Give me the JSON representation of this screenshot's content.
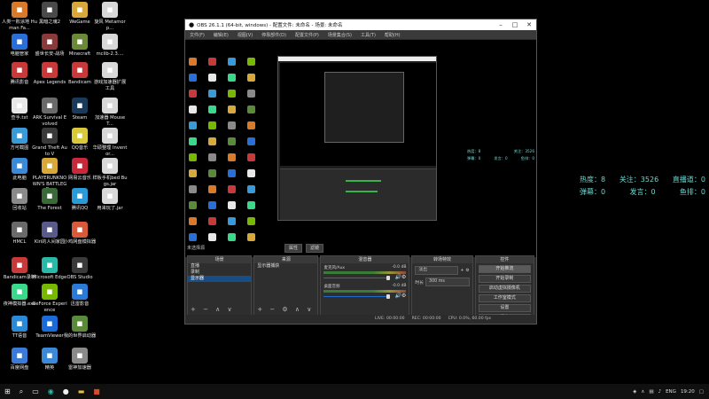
{
  "desktop": {
    "icons": [
      {
        "label": "人类一败涂地 Human Fa...",
        "icon": "game-icon",
        "color": "#d87a2a"
      },
      {
        "label": "电脑管家",
        "icon": "shield-icon",
        "color": "#2a6fd8"
      },
      {
        "label": "腾讯影音",
        "icon": "video-icon",
        "color": "#c83a3a"
      },
      {
        "label": "查手.txt",
        "icon": "text-file-icon",
        "color": "#e8e8e8"
      },
      {
        "label": "方可截图",
        "icon": "screenshot-icon",
        "color": "#3a9ad8"
      },
      {
        "label": "此电脑",
        "icon": "computer-icon",
        "color": "#3a8ad8"
      },
      {
        "label": "回收站",
        "icon": "recycle-bin-icon",
        "color": "#8a8a8a"
      },
      {
        "label": "HMCL",
        "icon": "minecraft-launcher-icon",
        "color": "#6a6a6a"
      },
      {
        "label": "Bandicam录制",
        "icon": "bandicam-icon",
        "color": "#c83a3a"
      },
      {
        "label": "夜神模拟器.exe",
        "icon": "android-emulator-icon",
        "color": "#3ad88a"
      },
      {
        "label": "TT语音",
        "icon": "tt-voice-icon",
        "color": "#2a8ad8"
      },
      {
        "label": "百度网盘",
        "icon": "cloud-drive-icon",
        "color": "#3a7ad8"
      },
      {
        "label": "黑暗之魂2",
        "icon": "game-icon",
        "color": "#4a4a4a"
      },
      {
        "label": "盛世长安-战场",
        "icon": "game-icon",
        "color": "#8a3a3a"
      },
      {
        "label": "Apex Legends",
        "icon": "apex-icon",
        "color": "#c83a3a"
      },
      {
        "label": "ARK Survival Evolved",
        "icon": "ark-icon",
        "color": "#6a6a6a"
      },
      {
        "label": "Grand Theft Auto V",
        "icon": "gta-icon",
        "color": "#3a3a3a"
      },
      {
        "label": "PLAYERUNKNOWN'S BATTLEGR...",
        "icon": "pubg-icon",
        "color": "#d8a83a"
      },
      {
        "label": "The Forest",
        "icon": "forest-icon",
        "color": "#3a6a3a"
      },
      {
        "label": "Kiri的人间家园",
        "icon": "game-icon",
        "color": "#5a5a8a"
      },
      {
        "label": "Microsoft Edge",
        "icon": "edge-icon",
        "color": "#2ab8a8"
      },
      {
        "label": "GeForce Experience",
        "icon": "geforce-icon",
        "color": "#76b900"
      },
      {
        "label": "TeamViewer",
        "icon": "teamviewer-icon",
        "color": "#1a6ad8"
      },
      {
        "label": "精英",
        "icon": "game-icon",
        "color": "#3a8ad8"
      },
      {
        "label": "WeGame",
        "icon": "wegame-icon",
        "color": "#d8a83a"
      },
      {
        "label": "Minecraft",
        "icon": "minecraft-icon",
        "color": "#6a8a3a"
      },
      {
        "label": "Bandicam",
        "icon": "bandicam-icon",
        "color": "#c83a3a"
      },
      {
        "label": "Steam",
        "icon": "steam-icon",
        "color": "#1a3a5a"
      },
      {
        "label": "QQ音乐",
        "icon": "qq-music-icon",
        "color": "#d8c83a"
      },
      {
        "label": "网易云音乐",
        "icon": "netease-music-icon",
        "color": "#c8283a"
      },
      {
        "label": "腾讯QQ",
        "icon": "qq-icon",
        "color": "#2a9ad8"
      },
      {
        "label": "小鸡网盘模拟器",
        "icon": "emulator-icon",
        "color": "#d85a3a"
      },
      {
        "label": "OBS Studio",
        "icon": "obs-icon",
        "color": "#3a3a3a"
      },
      {
        "label": "迅雷影音",
        "icon": "video-icon",
        "color": "#2a7ad8"
      },
      {
        "label": "我的世界启动器",
        "icon": "launcher-icon",
        "color": "#5a8a3a"
      },
      {
        "label": "雷神加速器",
        "icon": "accelerator-icon",
        "color": "#8a8a8a"
      },
      {
        "label": "旋风 Metamorp...",
        "icon": "app-icon",
        "color": "#d8d8d8"
      },
      {
        "label": "mclib-2.3....",
        "icon": "file-icon",
        "color": "#d8d8d8"
      },
      {
        "label": "游戏加速器扩展工具",
        "icon": "file-icon",
        "color": "#d8d8d8"
      },
      {
        "label": "加速器 Mouse T...",
        "icon": "file-icon",
        "color": "#d8d8d8"
      },
      {
        "label": "华硕整理 Inventor...",
        "icon": "file-icon",
        "color": "#d8d8d8"
      },
      {
        "label": "样板手机bed Bugs.jar",
        "icon": "jar-file-icon",
        "color": "#d8d8d8"
      },
      {
        "label": "用来玩了.jar",
        "icon": "jar-file-icon",
        "color": "#d8d8d8"
      }
    ]
  },
  "overlay": {
    "row1": {
      "a": "热度：8",
      "b": "关注：3526",
      "c": "直播道：0"
    },
    "row2": {
      "a": "弹幕：0",
      "b": "发言：0",
      "c": "鱼排：0"
    }
  },
  "obs": {
    "title": "OBS 26.1.1 (64-bit, windows) - 配置文件: 未命名 - 场景: 未命名",
    "menu": [
      "文件(F)",
      "编辑(E)",
      "视图(V)",
      "停靠部件(D)",
      "配置文件(P)",
      "场景集合(S)",
      "工具(T)",
      "帮助(H)"
    ],
    "scene_label": "未选择源",
    "scene_tools": [
      "属性",
      "滤镜"
    ],
    "docks": {
      "scenes": {
        "header": "场景",
        "items": [
          "直播",
          "录制",
          "显示器"
        ],
        "selected": 2
      },
      "sources": {
        "header": "来源",
        "items": [
          "显示器捕获"
        ]
      },
      "mixer": {
        "header": "混音器",
        "channels": [
          {
            "name": "麦克风/Aux",
            "db": "-0.0 dB"
          },
          {
            "name": "桌面音频",
            "db": "-0.0 dB"
          }
        ]
      },
      "transitions": {
        "header": "转场特效",
        "type": "淡出",
        "duration_label": "时长",
        "duration": "300 ms"
      },
      "controls": {
        "header": "控件",
        "buttons": [
          "开始推流",
          "开始录制",
          "启动虚拟摄像机",
          "工作室模式",
          "设置",
          "退出"
        ]
      }
    },
    "status": {
      "live": "LIVE: 00:00:00",
      "rec": "REC: 00:00:00",
      "cpu": "CPU: 0.0%, 60.00 fps"
    }
  },
  "taskbar": {
    "lang": "ENG",
    "time": "19:20"
  }
}
